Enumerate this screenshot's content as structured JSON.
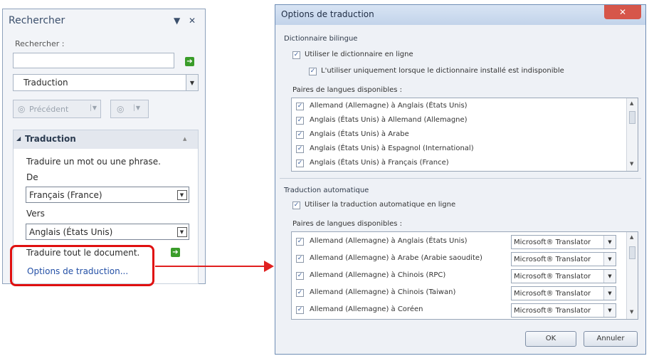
{
  "pane": {
    "title": "Rechercher",
    "search_label": "Rechercher :",
    "service": "Traduction",
    "prev_button": "Précédent",
    "section_title": "Traduction",
    "instruction": "Traduire un mot ou une phrase.",
    "from_label": "De",
    "from_value": "Français (France)",
    "to_label": "Vers",
    "to_value": "Anglais (États Unis)",
    "translate_doc": "Traduire tout le document.",
    "options_link": "Options de traduction..."
  },
  "dialog": {
    "title": "Options de traduction",
    "bilingual": {
      "heading": "Dictionnaire bilingue",
      "online_option": "Utiliser le dictionnaire en ligne",
      "only_if_missing": "L'utiliser uniquement lorsque le dictionnaire installé est indisponible",
      "pairs_label": "Paires de langues disponibles :",
      "pairs": [
        "Allemand (Allemagne) à Anglais (États Unis)",
        "Anglais (États Unis) à Allemand (Allemagne)",
        "Anglais (États Unis) à Arabe",
        "Anglais (États Unis) à Espagnol (International)",
        "Anglais (États Unis) à Français (France)"
      ]
    },
    "machine": {
      "heading": "Traduction automatique",
      "online_option": "Utiliser la traduction automatique en ligne",
      "pairs_label": "Paires de langues disponibles :",
      "pairs": [
        {
          "label": "Allemand (Allemagne) à Anglais (États Unis)",
          "service": "Microsoft® Translator"
        },
        {
          "label": "Allemand (Allemagne) à Arabe (Arabie saoudite)",
          "service": "Microsoft® Translator"
        },
        {
          "label": "Allemand (Allemagne) à Chinois (RPC)",
          "service": "Microsoft® Translator"
        },
        {
          "label": "Allemand (Allemagne) à Chinois (Taiwan)",
          "service": "Microsoft® Translator"
        },
        {
          "label": "Allemand (Allemagne) à Coréen",
          "service": "Microsoft® Translator"
        }
      ]
    },
    "ok_button": "OK",
    "cancel_button": "Annuler"
  },
  "colors": {
    "highlight": "#e01010",
    "link": "#2450a6",
    "go_button": "#3a9c2a"
  }
}
